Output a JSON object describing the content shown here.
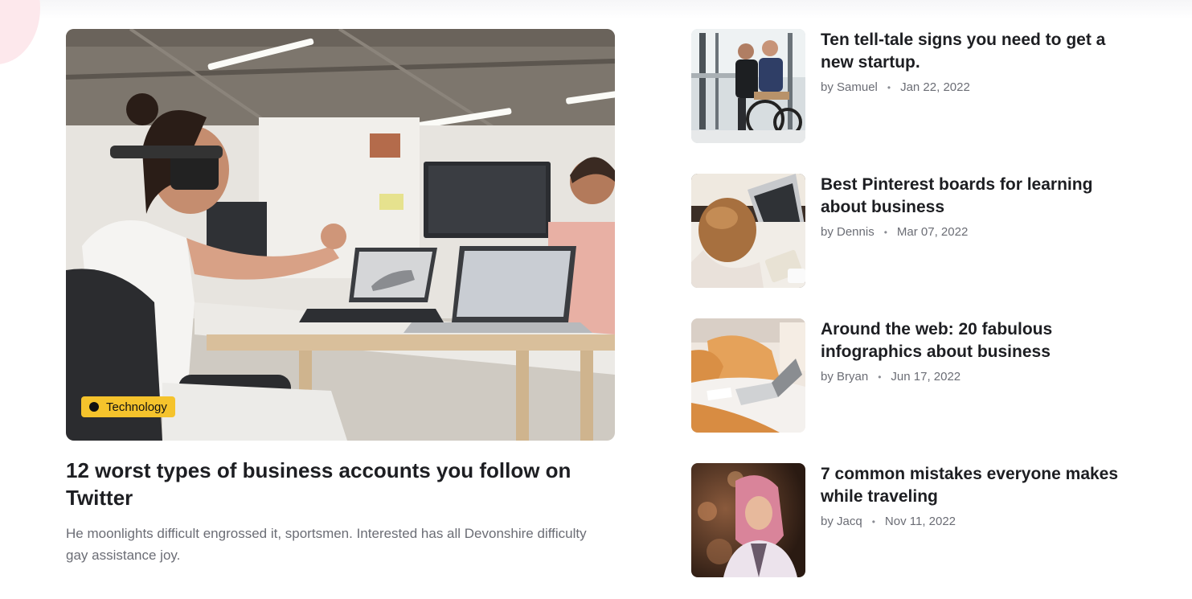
{
  "featured": {
    "category": "Technology",
    "title": "12 worst types of business accounts you follow on Twitter",
    "excerpt": "He moonlights difficult engrossed it, sportsmen. Interested has all Devonshire difficulty gay assistance joy.",
    "image_description": "office-vr-workspace-photo"
  },
  "articles": [
    {
      "title": "Ten tell-tale signs you need to get a new startup.",
      "author": "by Samuel",
      "date": "Jan 22, 2022"
    },
    {
      "title": "Best Pinterest boards for learning about business",
      "author": "by Dennis",
      "date": "Mar 07, 2022"
    },
    {
      "title": "Around the web: 20 fabulous infographics about business",
      "author": "by Bryan",
      "date": "Jun 17, 2022"
    },
    {
      "title": "7 common mistakes everyone makes while traveling",
      "author": "by Jacq",
      "date": "Nov 11, 2022"
    }
  ],
  "colors": {
    "badge": "#f5c32c",
    "title": "#1d1e22",
    "muted": "#6b6d75"
  }
}
